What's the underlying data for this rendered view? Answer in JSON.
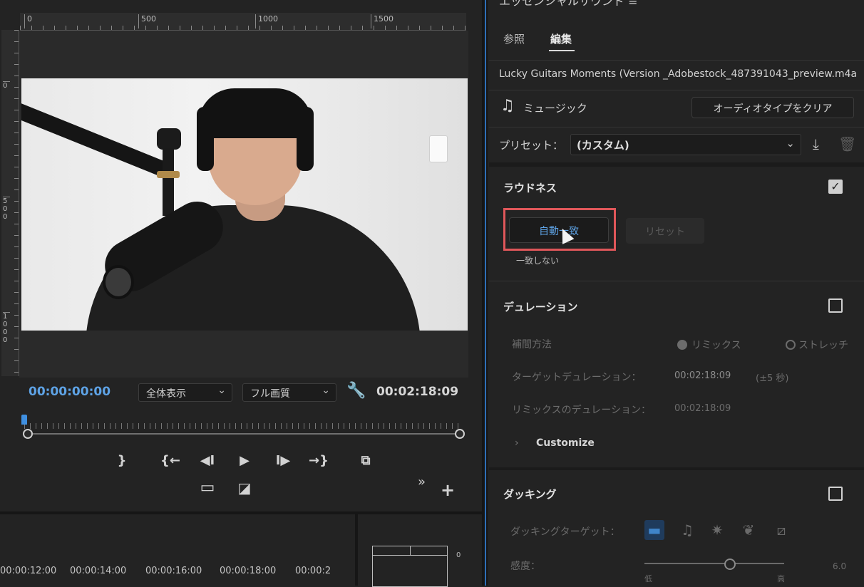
{
  "monitor": {
    "ruler_top": [
      "0",
      "500",
      "1000",
      "1500"
    ],
    "ruler_left": [
      {
        "label": "0"
      },
      {
        "label": "5\n0\n0"
      },
      {
        "label": "1\n0\n0\n0"
      }
    ],
    "timecode_current": "00:00:00:00",
    "zoom": "全体表示",
    "quality": "フル画質",
    "timecode_duration": "00:02:18:09",
    "transport": {
      "mark_out": "}",
      "go_in": "{←",
      "step_back": "◀I",
      "play": "▶",
      "step_fwd": "I▶",
      "go_out": "→}",
      "export_frame": "⧉",
      "safe_margins": "▭",
      "compare": "◪",
      "more": "»",
      "add": "+"
    }
  },
  "timeline": {
    "ticks": [
      "00:00:12:00",
      "00:00:14:00",
      "00:00:16:00",
      "00:00:18:00",
      "00:00:2"
    ],
    "meter_zero": "0"
  },
  "panel": {
    "title": "エッセンシャルサウンド ≡",
    "tabs": [
      {
        "label": "参照"
      },
      {
        "label": "編集"
      }
    ],
    "clip_name": "Lucky Guitars Moments (Version _Adobestock_487391043_preview.m4a",
    "type_label": "ミュージック",
    "clear_button": "オーディオタイプをクリア",
    "preset_label": "プリセット：",
    "preset_value": "(カスタム)",
    "loudness": {
      "title": "ラウドネス",
      "checked": true,
      "auto_match": "自動一致",
      "reset": "リセット",
      "status": "一致しない"
    },
    "duration": {
      "title": "デュレーション",
      "method_label": "補間方法",
      "remix": "リミックス",
      "stretch": "ストレッチ",
      "target_label": "ターゲットデュレーション：",
      "target_value": "00:02:18:09",
      "target_tolerance": "(±5 秒)",
      "remix_label": "リミックスのデュレーション：",
      "remix_value": "00:02:18:09",
      "customize": "Customize"
    },
    "ducking": {
      "title": "ダッキング",
      "target_label": "ダッキングターゲット：",
      "sensitivity_label": "感度：",
      "sensitivity_low": "低",
      "sensitivity_high": "高",
      "sensitivity_value": "6.0"
    }
  },
  "colors": {
    "accent_blue": "#5ea3e6",
    "highlight_red": "#e0575a"
  }
}
